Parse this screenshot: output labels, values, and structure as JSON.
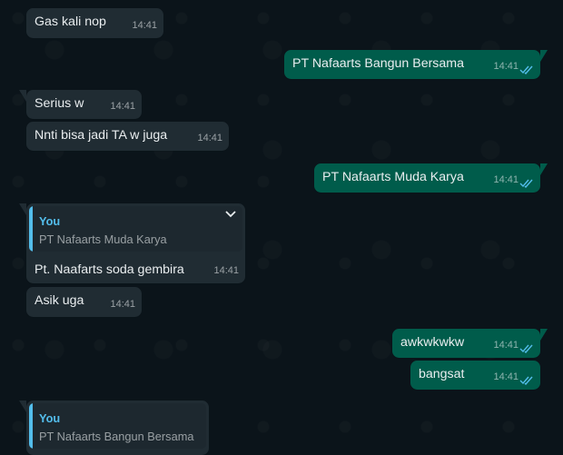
{
  "messages": [
    {
      "text": "Gas kali nop",
      "time": "14:41"
    },
    {
      "text": "PT Nafaarts Bangun Bersama",
      "time": "14:41"
    },
    {
      "text": "Serius w",
      "time": "14:41"
    },
    {
      "text": "Nnti bisa jadi TA w juga",
      "time": "14:41"
    },
    {
      "text": "PT Nafaarts Muda Karya",
      "time": "14:41"
    },
    {
      "quote_author": "You",
      "quote_text": "PT Nafaarts Muda Karya",
      "text": "Pt. Naafarts soda gembira",
      "time": "14:41"
    },
    {
      "text": "Asik uga",
      "time": "14:41"
    },
    {
      "text": "awkwkwkw",
      "time": "14:41"
    },
    {
      "text": "bangsat",
      "time": "14:41"
    },
    {
      "quote_author": "You",
      "quote_text": "PT Nafaarts Bangun Bersama"
    }
  ],
  "icons": {
    "read_receipt": "double-check-icon",
    "menu": "chevron-down-icon"
  },
  "colors": {
    "incoming": "#202c33",
    "outgoing": "#005c4b",
    "background": "#0b141a",
    "quote_accent": "#53bdeb"
  }
}
